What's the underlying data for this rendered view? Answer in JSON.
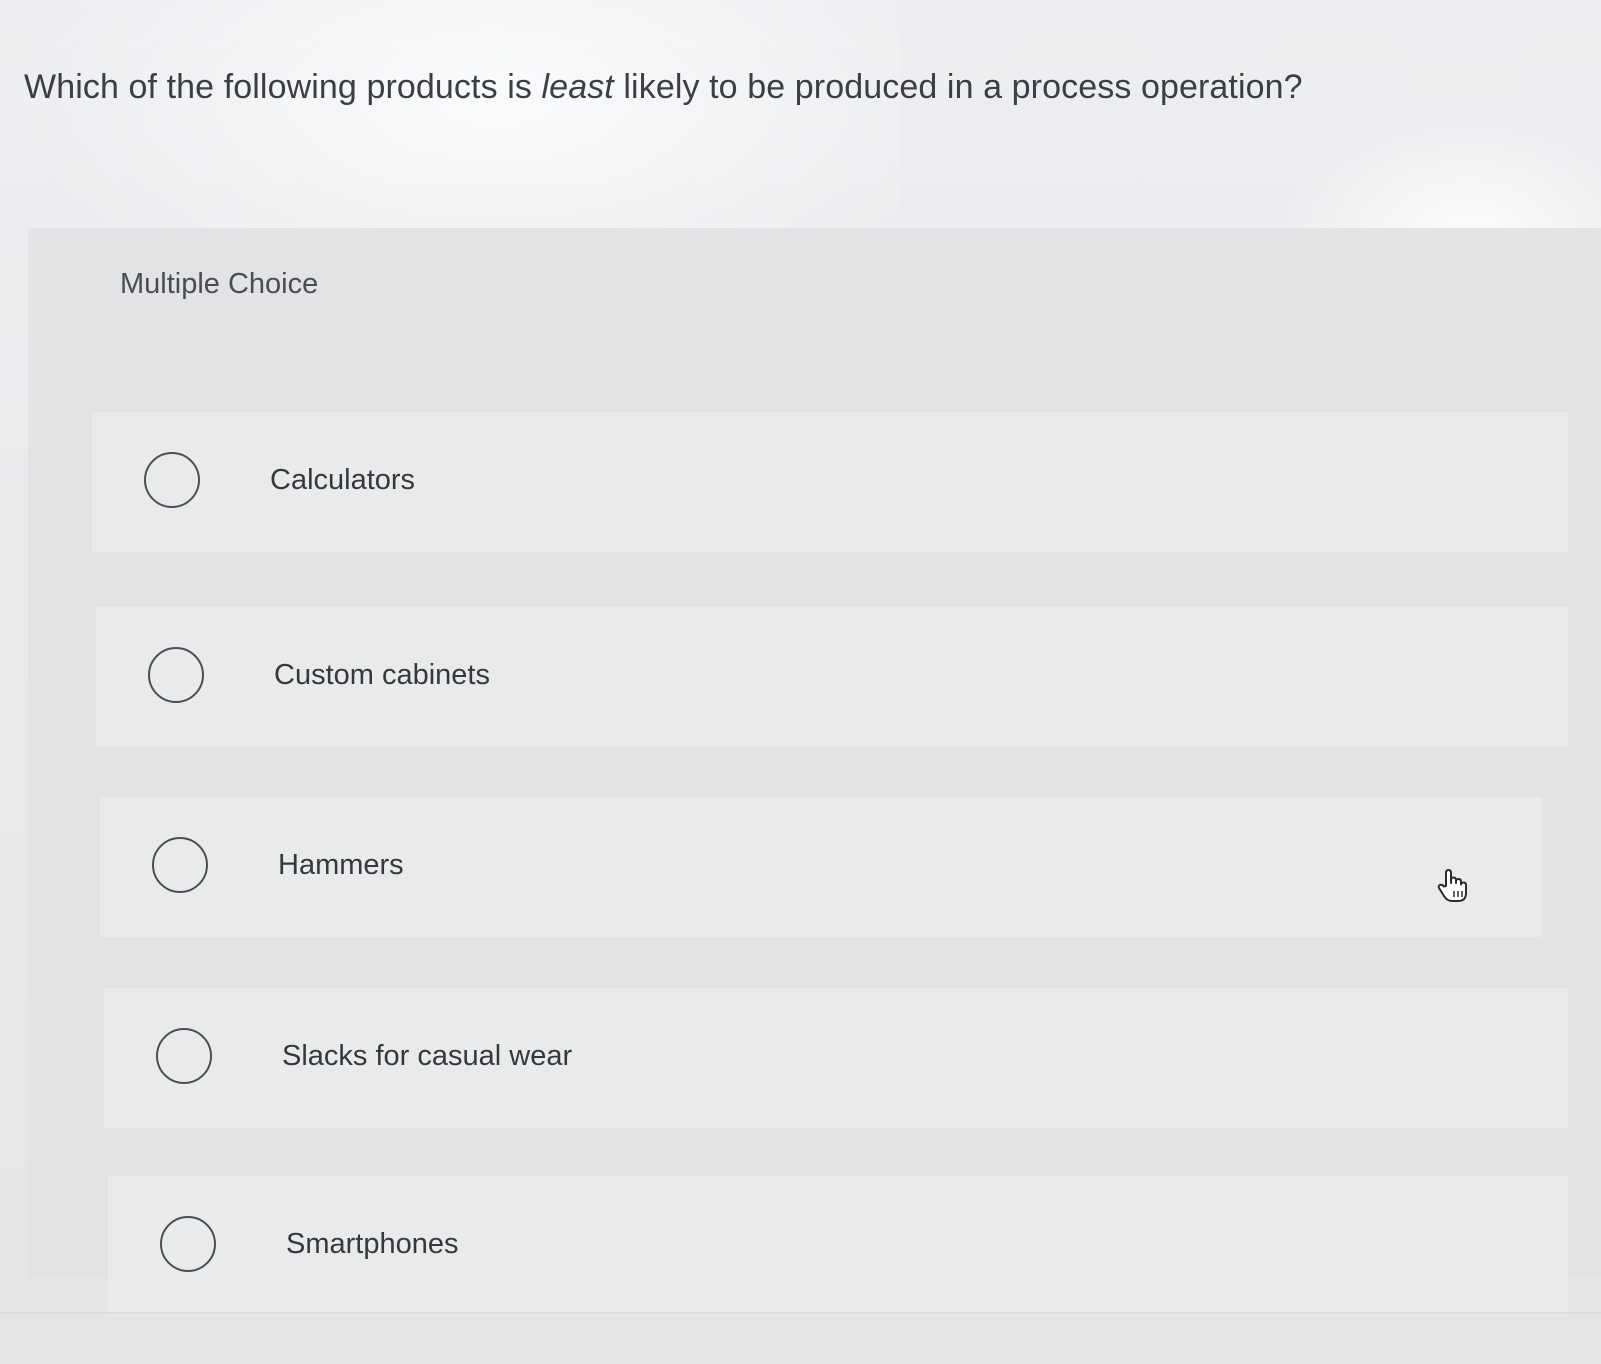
{
  "question": {
    "before": "Which of the following products is ",
    "emphasis": "least",
    "after": " likely to be produced in a process operation?"
  },
  "section_label": "Multiple Choice",
  "options": [
    {
      "label": "Calculators",
      "selected": false
    },
    {
      "label": "Custom cabinets",
      "selected": false
    },
    {
      "label": "Hammers",
      "selected": false
    },
    {
      "label": "Slacks for casual wear",
      "selected": false
    },
    {
      "label": "Smartphones",
      "selected": false
    }
  ],
  "cursor_icon": "pointer-hand-icon"
}
